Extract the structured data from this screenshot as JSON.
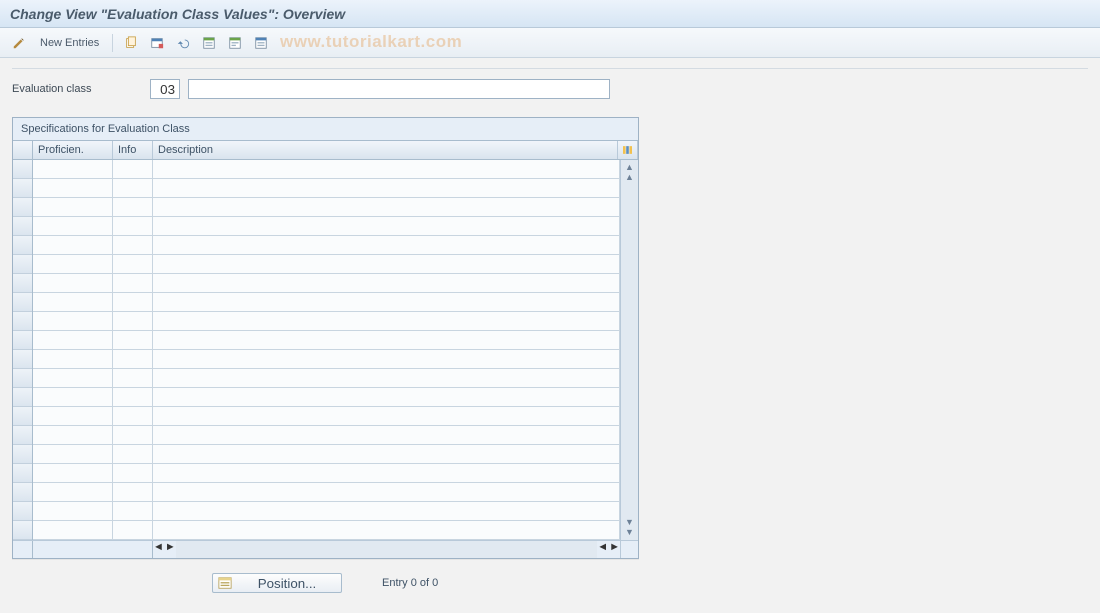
{
  "title": "Change View \"Evaluation Class Values\": Overview",
  "toolbar": {
    "new_entries_label": "New Entries"
  },
  "watermark": "www.tutorialkart.com",
  "field": {
    "label": "Evaluation class",
    "code": "03",
    "desc": ""
  },
  "panel": {
    "title": "Specifications for Evaluation Class",
    "columns": {
      "prof": "Proficien.",
      "info": "Info",
      "desc": "Description"
    }
  },
  "footer": {
    "position_label": "Position...",
    "entry_text": "Entry 0 of 0"
  }
}
